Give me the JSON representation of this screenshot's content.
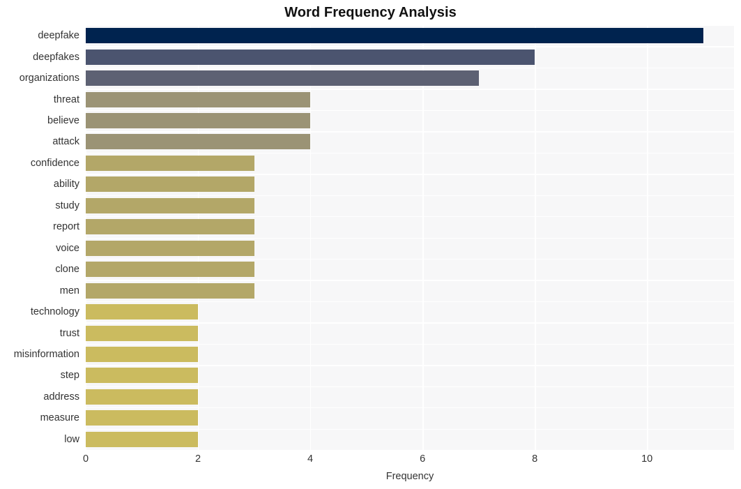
{
  "chart_data": {
    "type": "bar",
    "orientation": "horizontal",
    "title": "Word Frequency Analysis",
    "xlabel": "Frequency",
    "ylabel": "",
    "xlim": [
      0,
      11.55
    ],
    "xticks": [
      0,
      2,
      4,
      6,
      8,
      10
    ],
    "xtick_labels": [
      "0",
      "2",
      "4",
      "6",
      "8",
      "10"
    ],
    "grid": true,
    "legend": "none",
    "categories": [
      "deepfake",
      "deepfakes",
      "organizations",
      "threat",
      "believe",
      "attack",
      "confidence",
      "ability",
      "study",
      "report",
      "voice",
      "clone",
      "men",
      "technology",
      "trust",
      "misinformation",
      "step",
      "address",
      "measure",
      "low"
    ],
    "values": [
      11,
      8,
      7,
      4,
      4,
      4,
      3,
      3,
      3,
      3,
      3,
      3,
      3,
      2,
      2,
      2,
      2,
      2,
      2,
      2
    ],
    "bar_colors": [
      "#00234f",
      "#4b546f",
      "#5d6173",
      "#9b9375",
      "#9b9375",
      "#9b9375",
      "#b3a768",
      "#b3a768",
      "#b3a768",
      "#b3a768",
      "#b3a768",
      "#b3a768",
      "#b3a768",
      "#cbbb5f",
      "#cbbb5f",
      "#cbbb5f",
      "#cbbb5f",
      "#cbbb5f",
      "#cbbb5f",
      "#cbbb5f"
    ],
    "plot_background": "#f7f7f8",
    "figure_background": "#ffffff",
    "gridline_color": "#ffffff"
  }
}
